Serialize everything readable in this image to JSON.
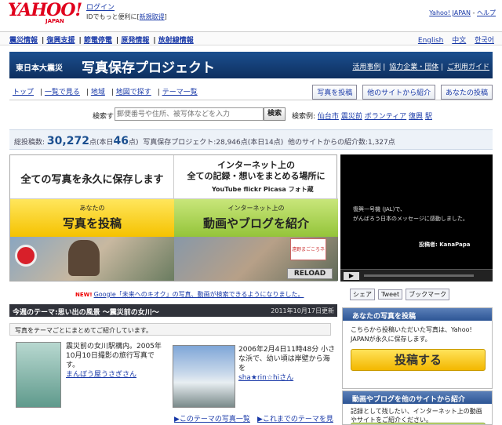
{
  "header": {
    "logo": "YAHOO!",
    "logo_sub": "JAPAN",
    "login": "ログイン",
    "login_sub": "IDでもっと便利に",
    "register": "新規取得",
    "top_right": "Yahoo! JAPAN",
    "help": "ヘルプ"
  },
  "nav1": {
    "items": [
      "震災情報",
      "復興支援",
      "節電停電",
      "原発情報",
      "放射線情報"
    ],
    "langs": [
      "English",
      "中文",
      "한국어"
    ]
  },
  "banner": {
    "prefix": "東日本大震災",
    "title": "写真保存プロジェクト",
    "links": [
      "活用事例",
      "協力企業・団体",
      "ご利用ガイド"
    ]
  },
  "nav2": {
    "items": [
      "トップ",
      "一覧で見る",
      "地域",
      "地図で探す",
      "テーマ一覧"
    ],
    "buttons": [
      "写真を投稿",
      "他のサイトから紹介",
      "あなたの投稿"
    ]
  },
  "search": {
    "label": "検索する",
    "placeholder": "郵便番号や住所、被写体などを入力",
    "button": "検索",
    "examples_label": "検索例:",
    "examples": [
      "仙台市",
      "震災前",
      "ボランティア",
      "復興",
      "駅"
    ]
  },
  "stats": {
    "total_label": "総投稿数:",
    "total": "30,272",
    "total_unit": "点",
    "today_label": "(本日",
    "today": "46",
    "today_unit": "点)",
    "project": "写真保存プロジェクト:28,946点(本日14点)",
    "other": "他のサイトからの紹介数:1,327点"
  },
  "promo": {
    "p1": "全ての写真を永久に保存します",
    "p2a": "インターネット上の",
    "p2b": "全ての記録・想いをまとめる場所に",
    "p2_logos": "YouTube flickr Picasa フォト蔵",
    "p3_small": "あなたの",
    "p3_big": "写真を投稿",
    "p4_small": "インターネット上の",
    "p4_big": "動画やブログを紹介",
    "p6_card": "遠野まごころネット",
    "reload": "RELOAD"
  },
  "video": {
    "line1": "復興一号機 (JAL)で、",
    "line2": "がんばろう日本のメッセージに感動しました。",
    "poster": "投稿者: KanaPapa"
  },
  "news": {
    "badge": "NEW!",
    "text": "Google「未来へのキオク」の写真、動画が検索できるようになりました。"
  },
  "share": {
    "buttons": [
      "シェア",
      "Tweet",
      "ブックマーク"
    ]
  },
  "theme": {
    "header": "今週のテーマ:思い出の風景 ～震災前の女川～",
    "date": "2011年10月17日更新",
    "intro": "写真をテーマごとにまとめてご紹介しています。",
    "item1_text": "震災前の女川駅構内。2005年10月10日撮影の旅行写真です。",
    "item1_author": "まんぼう屋うさぎさん",
    "item2_text": "2006年2月4日11時48分 小さな浜で、幼い頃は岸壁から海を",
    "item2_author": "sha★rin☆hiさん",
    "link1": "このテーマの写真一覧",
    "link2": "これまでのテーマを見る"
  },
  "right": {
    "box1_title": "あなたの写真を投稿",
    "box1_text": "こちらから投稿いただいた写真は、Yahoo! JAPANが永久に保存します。",
    "box1_button": "投稿する",
    "box2_title": "動画やブログを他のサイトから紹介",
    "box2_text": "記録として残したい、インターネット上の動画やサイトをご紹介ください。"
  }
}
